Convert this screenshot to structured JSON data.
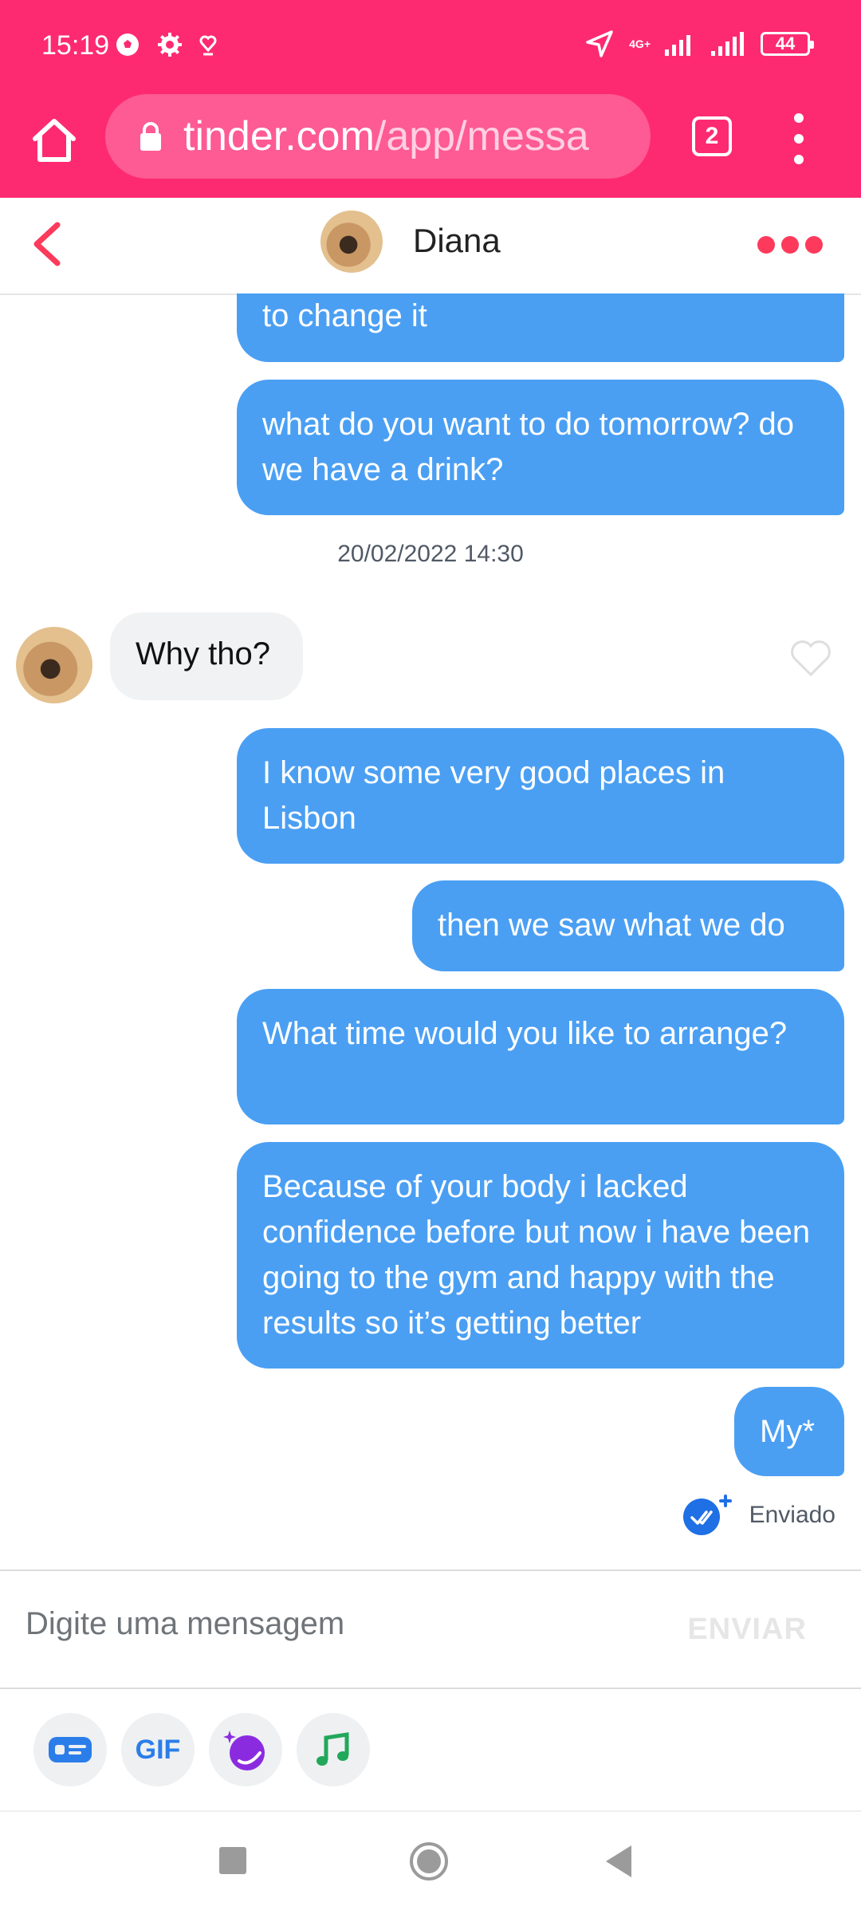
{
  "status_bar": {
    "time": "15:19",
    "network": "4G+",
    "battery": "44"
  },
  "browser": {
    "url_domain": "tinder.com",
    "url_path": "/app/messa",
    "tab_count": "2"
  },
  "chat": {
    "contact_name": "Diana",
    "timestamp": "20/02/2022 14:30",
    "messages": [
      {
        "side": "sent",
        "text": "to change it"
      },
      {
        "side": "sent",
        "text": "what do you want to do tomorrow? do we have a drink?"
      },
      {
        "side": "received",
        "text": "Why tho?"
      },
      {
        "side": "sent",
        "text": "I know some very good places in Lisbon"
      },
      {
        "side": "sent",
        "text": "then we saw what we do"
      },
      {
        "side": "sent",
        "text": "What time would you like to arrange?"
      },
      {
        "side": "sent",
        "text": "Because of your body i lacked confidence before but now i have been going to the gym and happy with the results so it’s getting better"
      },
      {
        "side": "sent",
        "text": "My*"
      }
    ],
    "sent_status": "Enviado"
  },
  "composer": {
    "placeholder": "Digite uma mensagem",
    "send_label": "ENVIAR"
  },
  "toolbar": {
    "gif_label": "GIF"
  },
  "colors": {
    "brand_pink": "#fe2a71",
    "sent_bubble": "#4a9ff3",
    "received_bubble": "#f0f2f4",
    "accent_red": "#fd3a5c"
  }
}
